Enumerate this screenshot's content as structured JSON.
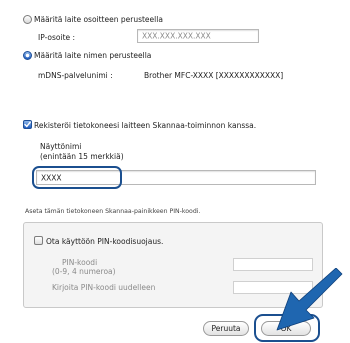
{
  "connection": {
    "by_address_label": "Määritä laite osoitteen perusteella",
    "ip_label": "IP-osoite :",
    "ip_placeholder": "XXX.XXX.XXX.XXX",
    "by_name_label": "Määritä laite nimen perusteella",
    "mdns_label": "mDNS-palvelunimi :",
    "mdns_value": "Brother MFC-XXXX  [XXXXXXXXXXXX]",
    "selected": "by_name"
  },
  "register": {
    "checkbox_label": "Rekisteröi tietokoneesi laitteen Skannaa-toiminnon kanssa.",
    "checked": true,
    "display_name_label": "Näyttönimi",
    "display_name_hint": "(enintään 15 merkkiä)",
    "display_name_value": "XXXX"
  },
  "pin": {
    "section_caption": "Aseta tämän tietokoneen Skannaa-painikkeen PIN-koodi.",
    "enable_label": "Ota käyttöön PIN-koodisuojaus.",
    "enabled": false,
    "pin_label": "PIN-koodi",
    "pin_hint": "(0-9, 4 numeroa)",
    "confirm_label": "Kirjoita PIN-koodi uudelleen"
  },
  "buttons": {
    "cancel_label": "Peruuta",
    "ok_label": "OK"
  },
  "colors": {
    "highlight": "#1b4f8f",
    "arrow": "#1f66b0"
  }
}
